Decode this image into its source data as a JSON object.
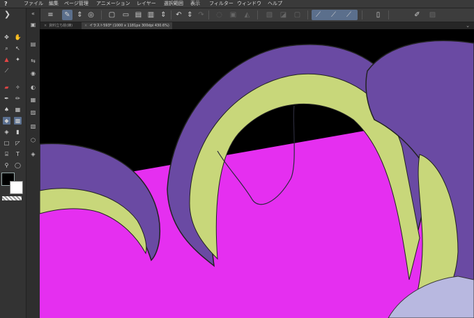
{
  "app": {
    "logo": "?"
  },
  "menu": [
    {
      "label": "ファイル"
    },
    {
      "label": "編集"
    },
    {
      "label": "ページ管理"
    },
    {
      "label": "アニメーション"
    },
    {
      "label": "レイヤー"
    },
    {
      "label": "選択範囲"
    },
    {
      "label": "表示"
    },
    {
      "label": "フィルター"
    },
    {
      "label": "ウィンドウ"
    },
    {
      "label": "ヘルプ"
    }
  ],
  "tabs": [
    {
      "label": "資料立ち絵(練)"
    },
    {
      "label": "イラスト593* (1000 x 1181px 300dpi 430.6%)"
    }
  ],
  "colors": {
    "main_color": "#000000",
    "sub_color": "#ffffff",
    "canvas_magenta": "#e52ff0",
    "tentacle_purple": "#6a4aa3",
    "sucker_green": "#c8d77a"
  }
}
